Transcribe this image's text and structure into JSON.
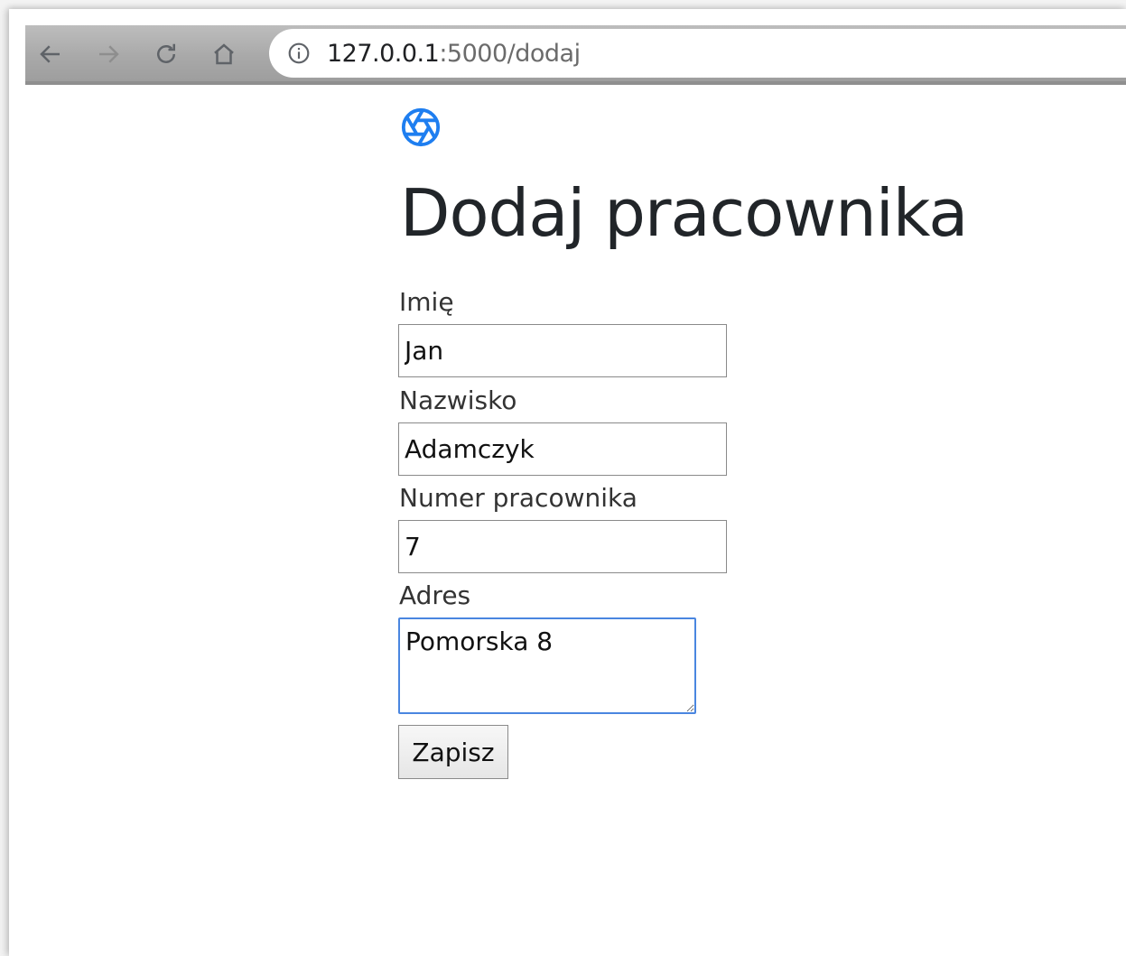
{
  "browser": {
    "url_host": "127.0.0.1",
    "url_path": ":5000/dodaj",
    "icons": {
      "back": "arrow-left-icon",
      "forward": "arrow-right-icon",
      "reload": "reload-icon",
      "home": "home-icon",
      "info": "info-icon"
    }
  },
  "page": {
    "logo_icon": "aperture-icon",
    "title": "Dodaj pracownika",
    "accent_color": "#1e7ef0"
  },
  "form": {
    "first_name": {
      "label": "Imię",
      "value": "Jan"
    },
    "last_name": {
      "label": "Nazwisko",
      "value": "Adamczyk"
    },
    "employee_number": {
      "label": "Numer pracownika",
      "value": "7"
    },
    "address": {
      "label": "Adres",
      "value": "Pomorska 8"
    },
    "submit_label": "Zapisz"
  }
}
